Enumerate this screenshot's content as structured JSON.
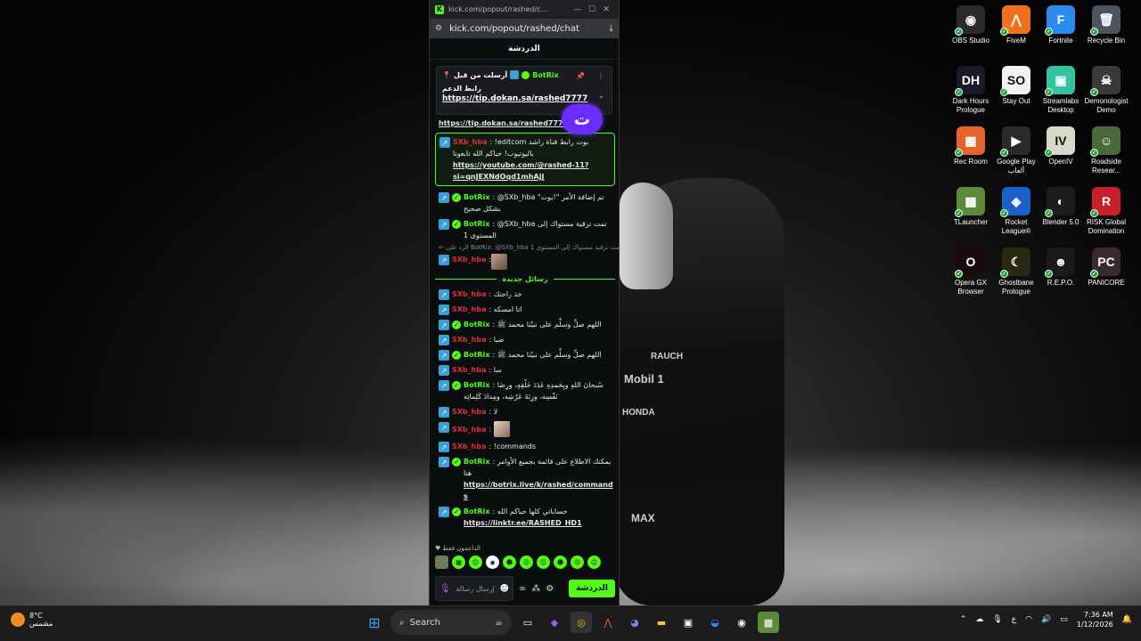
{
  "browser": {
    "tab_title": "kick.com/popout/rashed/c...",
    "url": "kick.com/popout/rashed/chat",
    "window_min": "—",
    "window_max": "☐",
    "window_close": "✕"
  },
  "chat": {
    "header": "الدردشة",
    "pinned": {
      "label": "أرسلت من قبل",
      "user": "BotRix",
      "title": "رابط الدعم",
      "link": "https://tip.dokan.sa/rashed7777"
    },
    "messages": [
      {
        "type": "link",
        "text": "https://tip.dokan.sa/rashed7777"
      },
      {
        "type": "highlight",
        "user": "SXb_hba",
        "text": "!editcom بوت رابط قناة راشد باليوتيوب! حياكم الله تابعونا",
        "link": "https://youtube.com/@rashed-11?si=qnJEXNdOqd1mhAjJ"
      },
      {
        "type": "bot",
        "user": "BotRix",
        "text": "@SXb_hba تم إضافة الأمر \"!بوت\" بشكل صحيح"
      },
      {
        "type": "bot",
        "user": "BotRix",
        "text": "@SXb_hba تمت ترقية مستواك إلى المستوى 1"
      },
      {
        "type": "reply",
        "text": "الرد على BotRix: @SXb_hba تمت ترقية مستواك إلى المستوى 1"
      },
      {
        "type": "sx-thumb",
        "user": "SXb_hba"
      }
    ],
    "divider": "رسائل جديدة",
    "new_messages": [
      {
        "kind": "sx",
        "user": "SXb_hba",
        "text": "خذ راحتك"
      },
      {
        "kind": "sx",
        "user": "SXb_hba",
        "text": "انا امسكه"
      },
      {
        "kind": "bot",
        "user": "BotRix",
        "text": "اللهم صلِّ وسلِّم على نبيّنا محمد ﷺ"
      },
      {
        "kind": "sx",
        "user": "SXb_hba",
        "text": "صبا"
      },
      {
        "kind": "bot",
        "user": "BotRix",
        "text": "اللهم صلِّ وسلِّم على نبيّنا محمد ﷺ"
      },
      {
        "kind": "sx",
        "user": "SXb_hba",
        "text": "سا"
      },
      {
        "kind": "bot",
        "user": "BotRix",
        "text": "سُبحانَ اللهِ وبِحَمدِهِ عَدَدَ خَلْقِهِ، ورِضَا نَفْسِه، وزِنَةَ عَرْشِه، ومِدادَ كَلِماتِه"
      },
      {
        "kind": "sx",
        "user": "SXb_hba",
        "text": "لا"
      },
      {
        "kind": "sx-thumb",
        "user": "SXb_hba",
        "text": ""
      },
      {
        "kind": "sx",
        "user": "SXb_hba",
        "text": "!commands"
      },
      {
        "kind": "bot",
        "user": "BotRix",
        "text": "يمكنك الاطلاع على قائمة بجميع الأوامر هنا",
        "link": "https://botrix.live/k/rashed/commands"
      },
      {
        "kind": "bot",
        "user": "BotRix",
        "text": "حساباتي كلها حياكم الله",
        "link": "https://linktr.ee/RASHED_HD1"
      }
    ],
    "supporters": "الداعمون فقط",
    "input_placeholder": "إرسال رسالة",
    "send_button": "الدردشة"
  },
  "desktop_icons": [
    {
      "label": "OBS Studio",
      "bg": "#2b2b2b",
      "glyph": "◉"
    },
    {
      "label": "FiveM",
      "bg": "#f0701f",
      "glyph": "⋀"
    },
    {
      "label": "Fortnite",
      "bg": "#2a8af0",
      "glyph": "F"
    },
    {
      "label": "Recycle Bin",
      "bg": "#4a5560",
      "glyph": "🗑"
    },
    {
      "label": "Dark Hours Prologue",
      "bg": "#1a1a2a",
      "glyph": "DH"
    },
    {
      "label": "Stay Out",
      "bg": "#f2f2f2",
      "glyph": "SO"
    },
    {
      "label": "Streamlabs Desktop",
      "bg": "#31c3a2",
      "glyph": "▣"
    },
    {
      "label": "Demonologist Demo",
      "bg": "#3a3a3a",
      "glyph": "☠"
    },
    {
      "label": "Rec Room",
      "bg": "#e8622c",
      "glyph": "▦"
    },
    {
      "label": "Google Play ألعاب",
      "bg": "#2a2a2a",
      "glyph": "▶"
    },
    {
      "label": "OpenIV",
      "bg": "#d8d8c8",
      "glyph": "IV"
    },
    {
      "label": "Roadside Resear...",
      "bg": "#4a6a3a",
      "glyph": "☺"
    },
    {
      "label": "TLauncher",
      "bg": "#5a8a3a",
      "glyph": "▩"
    },
    {
      "label": "Rocket League®",
      "bg": "#1d5fc8",
      "glyph": "◈"
    },
    {
      "label": "Blender 5.0",
      "bg": "#1c1c1c",
      "glyph": "◐"
    },
    {
      "label": "RISK Global Domination",
      "bg": "#c8202a",
      "glyph": "R"
    },
    {
      "label": "Opera GX Browser",
      "bg": "#1a0a0e",
      "glyph": "O"
    },
    {
      "label": "Ghostbane Prologue",
      "bg": "#2a2a14",
      "glyph": "☾"
    },
    {
      "label": "R.E.P.O.",
      "bg": "#1a1a1a",
      "glyph": "☻"
    },
    {
      "label": "PANICORE",
      "bg": "#3a2a30",
      "glyph": "PC"
    }
  ],
  "taskbar": {
    "weather_temp": "8°C",
    "weather_desc": "مشمس",
    "search_label": "Search",
    "lang": "ع",
    "time": "7:36 AM",
    "date": "1/12/2026"
  }
}
